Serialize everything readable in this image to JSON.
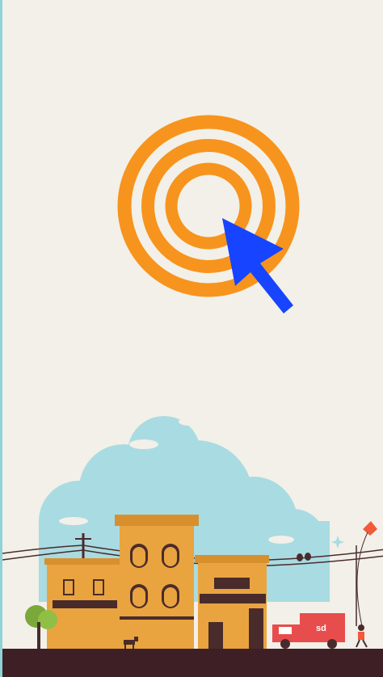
{
  "screen": {
    "name": "splash-screen",
    "background": "#f2f0e8",
    "accent": "#f7941d",
    "pointer_color": "#1744ff"
  },
  "illustration": {
    "truck_label": "sd"
  },
  "icons": [
    "target-icon",
    "cursor-arrow-icon"
  ]
}
